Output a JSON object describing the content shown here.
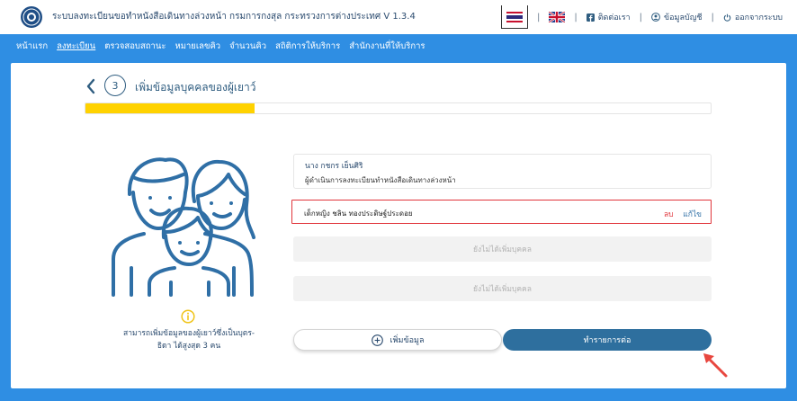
{
  "header": {
    "site_title": "ระบบลงทะเบียนขอทำหนังสือเดินทางล่วงหน้า กรมการกงสุล กระทรวงการต่างประเทศ V 1.3.4",
    "links": {
      "contact": "ติดต่อเรา",
      "account": "ข้อมูลบัญชี",
      "logout": "ออกจากระบบ"
    },
    "separator": "|"
  },
  "nav": {
    "items": [
      {
        "label": "หน้าแรก",
        "active": false
      },
      {
        "label": "ลงทะเบียน",
        "active": true
      },
      {
        "label": "ตรวจสอบสถานะ",
        "active": false
      },
      {
        "label": "หมายเลขคิว",
        "active": false
      },
      {
        "label": "จำนวนคิว",
        "active": false
      },
      {
        "label": "สถิติการให้บริการ",
        "active": false
      },
      {
        "label": "สำนักงานที่ให้บริการ",
        "active": false
      }
    ]
  },
  "step": {
    "number": "3",
    "title": "เพิ่มข้อมูลบุคคลของผู้เยาว์",
    "progress_fraction": 0.27
  },
  "info": {
    "text": "สามารถเพิ่มข้อมูลของผู้เยาว์ซึ่งเป็นบุตร-ธิดา ได้สูงสุด 3 คน"
  },
  "guardian": {
    "name": "นาง กชกร เย็นศิริ",
    "role": "ผู้ดำเนินการลงทะเบียนทำหนังสือเดินทางล่วงหน้า"
  },
  "children": [
    {
      "name": "เด็กหญิง ชลิน ทองประดิษฐ์ประดอย",
      "delete_label": "ลบ",
      "edit_label": "แก้ไข"
    }
  ],
  "empty_slots": [
    {
      "label": "ยังไม่ได้เพิ่มบุคคล"
    },
    {
      "label": "ยังไม่ได้เพิ่มบุคคล"
    }
  ],
  "buttons": {
    "add": "เพิ่มข้อมูล",
    "next": "ทำรายการต่อ"
  },
  "colors": {
    "page_bg": "#2f8ee3",
    "primary": "#2e6f9e",
    "progress": "#ffd200",
    "highlight": "#e0343a",
    "illustration": "#2f6fa6",
    "info_icon": "#f0c419"
  }
}
